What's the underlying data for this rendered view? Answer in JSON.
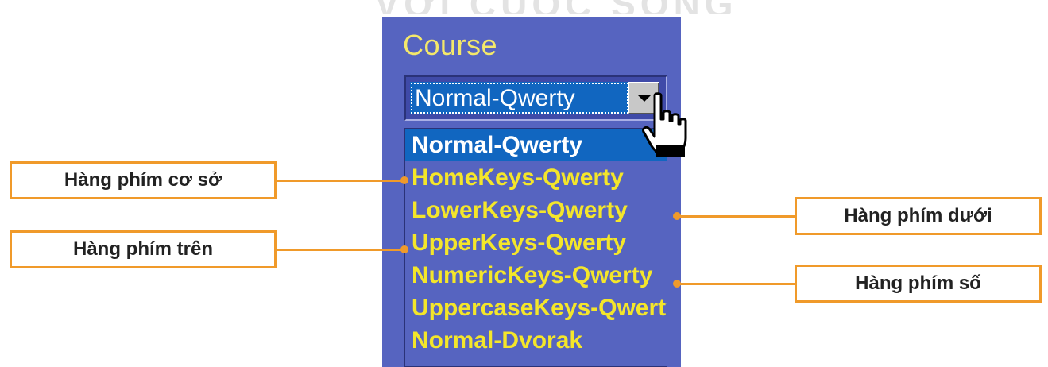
{
  "watermark": "VỚI CUỘC SỐNG",
  "course": {
    "label": "Course",
    "selected_value": "Normal-Qwerty",
    "dropdown_arrow_icon": "chevron-down-icon",
    "options": [
      "Normal-Qwerty",
      "HomeKeys-Qwerty",
      "LowerKeys-Qwerty",
      "UpperKeys-Qwerty",
      "NumericKeys-Qwerty",
      "UppercaseKeys-Qwerty",
      "Normal-Dvorak"
    ]
  },
  "callouts": {
    "home_row": "Hàng phím cơ sở",
    "top_row": "Hàng phím trên",
    "bottom_row": "Hàng phím dưới",
    "number_row": "Hàng phím số"
  },
  "colors": {
    "panel": "#5664c0",
    "selection": "#1166c0",
    "item_text": "#f4e62a",
    "callout_border": "#f09a2a"
  }
}
